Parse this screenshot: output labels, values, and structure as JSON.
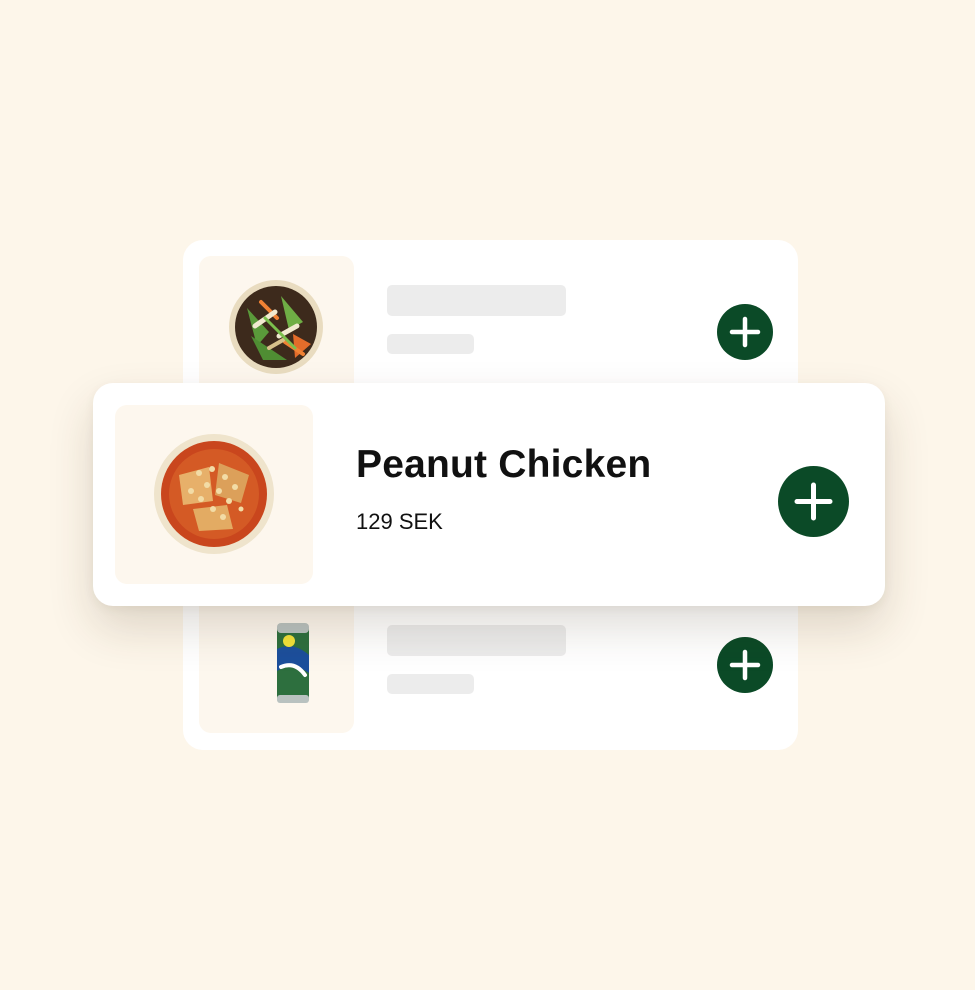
{
  "menu": {
    "featured_item": {
      "name": "Peanut Chicken",
      "price": "129 SEK",
      "image_icon": "peanut-chicken-bowl-icon",
      "add_icon": "plus-icon"
    },
    "placeholder_items": [
      {
        "image_icon": "salad-bowl-icon",
        "add_icon": "plus-icon"
      },
      {
        "image_icon": "soda-can-icon",
        "add_icon": "plus-icon"
      }
    ]
  },
  "colors": {
    "background": "#fdf6ea",
    "card": "#ffffff",
    "thumb_background": "#fdf7ee",
    "skeleton": "#ececec",
    "add_button": "#0b4a27",
    "text": "#111111"
  }
}
